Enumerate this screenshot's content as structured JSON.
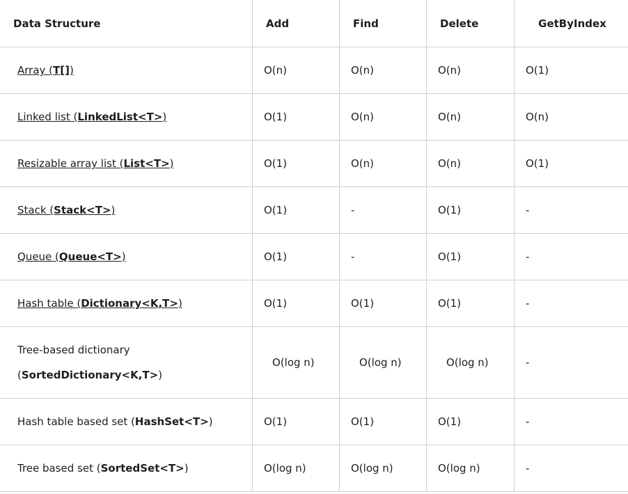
{
  "headers": [
    "Data Structure",
    "Add",
    "Find",
    "Delete",
    "GetByIndex"
  ],
  "rows": [
    {
      "name": "Array ",
      "type": "T[]",
      "link": true,
      "add": "O(n)",
      "find": "O(n)",
      "delete": "O(n)",
      "index": "O(1)"
    },
    {
      "name": "Linked list ",
      "type": "LinkedList<T>",
      "link": true,
      "add": "O(1)",
      "find": "O(n)",
      "delete": "O(n)",
      "index": "O(n)"
    },
    {
      "name": "Resizable array list ",
      "type": "List<T>",
      "link": true,
      "add": "O(1)",
      "find": "O(n)",
      "delete": "O(n)",
      "index": "O(1)"
    },
    {
      "name": "Stack ",
      "type": "Stack<T>",
      "link": true,
      "add": "O(1)",
      "find": "-",
      "delete": "O(1)",
      "index": "-"
    },
    {
      "name": "Queue ",
      "type": "Queue<T>",
      "link": true,
      "add": "O(1)",
      "find": "-",
      "delete": "O(1)",
      "index": "-"
    },
    {
      "name": "Hash table ",
      "type": "Dictionary<K,T>",
      "link": true,
      "add": "O(1)",
      "find": "O(1)",
      "delete": "O(1)",
      "index": "-"
    },
    {
      "name": "Tree-based dictionary ",
      "type": "SortedDictionary<K,T>",
      "link": false,
      "tall": true,
      "add": "O(log n)",
      "find": "O(log n)",
      "delete": "O(log n)",
      "index": "-"
    },
    {
      "name": "Hash table based set ",
      "type": "HashSet<T>",
      "link": false,
      "add": "O(1)",
      "find": "O(1)",
      "delete": "O(1)",
      "index": "-"
    },
    {
      "name": "Tree based set ",
      "type": "SortedSet<T>",
      "link": false,
      "add": "O(log n)",
      "find": "O(log n)",
      "delete": "O(log n)",
      "index": "-"
    }
  ]
}
